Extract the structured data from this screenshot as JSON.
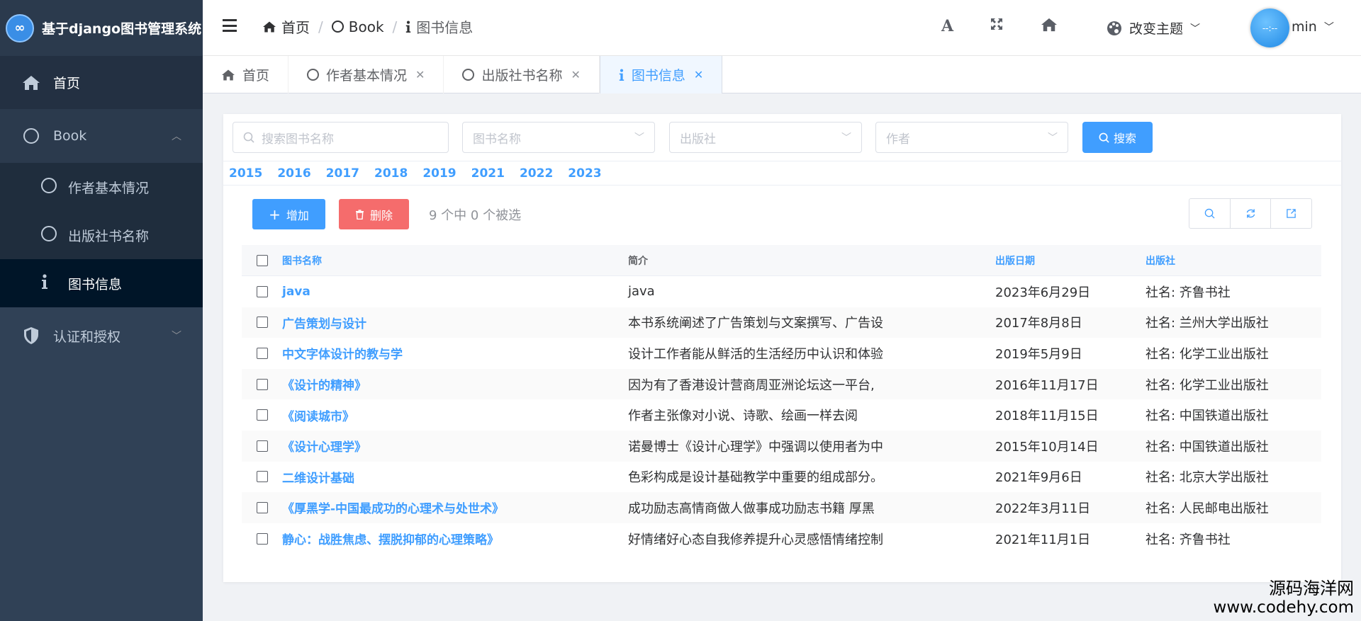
{
  "app": {
    "logo_symbol": "∞",
    "title": "基于django图书管理系统"
  },
  "sidebar": {
    "home": {
      "label": "首页",
      "icon": "home-icon"
    },
    "book": {
      "label": "Book",
      "icon": "circle-icon"
    },
    "book_items": [
      {
        "label": "作者基本情况",
        "icon": "circle-icon"
      },
      {
        "label": "出版社书名称",
        "icon": "circle-icon"
      },
      {
        "label": "图书信息",
        "icon": "info-icon",
        "active": true
      }
    ],
    "auth": {
      "label": "认证和授权",
      "icon": "shield-icon"
    }
  },
  "header": {
    "breadcrumb": [
      "首页",
      "Book",
      "图书信息"
    ],
    "theme_label": "改变主题",
    "avatar_text": "--:--",
    "user_name": "min"
  },
  "tabs": [
    {
      "label": "首页",
      "closable": false,
      "active": false
    },
    {
      "label": "作者基本情况",
      "closable": true,
      "active": false
    },
    {
      "label": "出版社书名称",
      "closable": true,
      "active": false
    },
    {
      "label": "图书信息",
      "closable": true,
      "active": true
    }
  ],
  "filters": {
    "search_placeholder": "搜索图书名称",
    "name_placeholder": "图书名称",
    "publisher_placeholder": "出版社",
    "author_placeholder": "作者",
    "search_button": "搜索"
  },
  "years": [
    "2015",
    "2016",
    "2017",
    "2018",
    "2019",
    "2021",
    "2022",
    "2023"
  ],
  "toolbar": {
    "add_label": "增加",
    "delete_label": "删除",
    "selection_info": "9 个中 0 个被选"
  },
  "table": {
    "headers": {
      "name": "图书名称",
      "desc": "简介",
      "date": "出版日期",
      "publisher": "出版社"
    },
    "rows": [
      {
        "name": "java",
        "desc": "java",
        "date": "2023年6月29日",
        "publisher": "社名: 齐鲁书社"
      },
      {
        "name": "广告策划与设计",
        "desc": "本书系统阐述了广告策划与文案撰写、广告设",
        "date": "2017年8月8日",
        "publisher": "社名: 兰州大学出版社"
      },
      {
        "name": "中文字体设计的教与学",
        "desc": "设计工作者能从鲜活的生活经历中认识和体验",
        "date": "2019年5月9日",
        "publisher": "社名: 化学工业出版社"
      },
      {
        "name": "《设计的精神》",
        "desc": "因为有了香港设计营商周亚洲论坛这一平台,",
        "date": "2016年11月17日",
        "publisher": "社名: 化学工业出版社"
      },
      {
        "name": "《阅读城市》",
        "desc": "作者主张像对小说、诗歌、绘画一样去阅",
        "date": "2018年11月15日",
        "publisher": "社名: 中国铁道出版社"
      },
      {
        "name": "《设计心理学》",
        "desc": "诺曼博士《设计心理学》中强调以使用者为中",
        "date": "2015年10月14日",
        "publisher": "社名: 中国铁道出版社"
      },
      {
        "name": "二维设计基础",
        "desc": "色彩构成是设计基础教学中重要的组成部分。",
        "date": "2021年9月6日",
        "publisher": "社名: 北京大学出版社"
      },
      {
        "name": "《厚黑学-中国最成功的心理术与处世术》",
        "desc": "成功励志高情商做人做事成功励志书籍 厚黑",
        "date": "2022年3月11日",
        "publisher": "社名: 人民邮电出版社"
      },
      {
        "name": "静心：战胜焦虑、摆脱抑郁的心理策略》",
        "desc": "好情绪好心态自我修养提升心灵感悟情绪控制",
        "date": "2021年11月1日",
        "publisher": "社名: 齐鲁书社"
      }
    ]
  },
  "brand": {
    "line1": "源码海洋网",
    "line2": "www.codehy.com"
  }
}
